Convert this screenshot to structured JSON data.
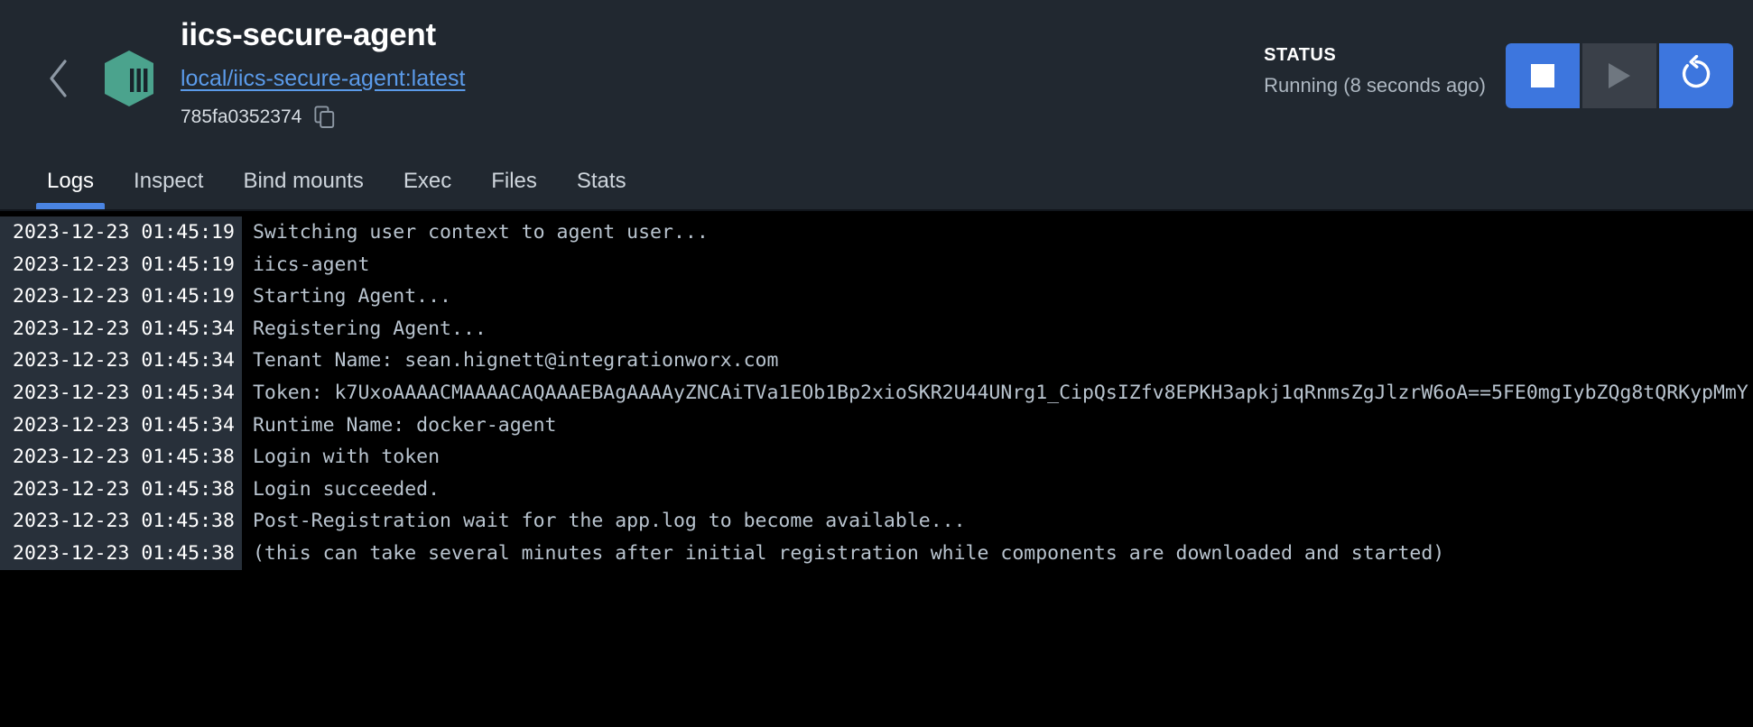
{
  "header": {
    "back_icon": "chevron-left-icon",
    "container_icon": "container-hexagon-icon",
    "container_name": "iics-secure-agent",
    "image_link": "local/iics-secure-agent:latest",
    "container_id": "785fa0352374",
    "copy_icon": "copy-icon",
    "status_label": "STATUS",
    "status_value": "Running (8 seconds ago)",
    "controls": {
      "stop": {
        "label": "Stop",
        "icon": "stop-square-icon",
        "enabled": true
      },
      "start": {
        "label": "Start",
        "icon": "play-triangle-icon",
        "enabled": false
      },
      "restart": {
        "label": "Restart",
        "icon": "restart-circular-arrow-icon",
        "enabled": true
      }
    }
  },
  "colors": {
    "header_bg": "#212830",
    "logs_bg": "#000000",
    "accent_blue": "#4a84e2",
    "button_blue": "#3d76de",
    "link_blue": "#5b9bea",
    "container_teal": "#4ba38d",
    "timestamp_bg": "#28303a",
    "log_text": "#b9c4cf"
  },
  "tabs": [
    {
      "label": "Logs",
      "active": true
    },
    {
      "label": "Inspect",
      "active": false
    },
    {
      "label": "Bind mounts",
      "active": false
    },
    {
      "label": "Exec",
      "active": false
    },
    {
      "label": "Files",
      "active": false
    },
    {
      "label": "Stats",
      "active": false
    }
  ],
  "logs": [
    {
      "timestamp": "2023-12-23 01:45:19",
      "message": "Switching user context to agent user..."
    },
    {
      "timestamp": "2023-12-23 01:45:19",
      "message": "iics-agent"
    },
    {
      "timestamp": "2023-12-23 01:45:19",
      "message": "Starting Agent..."
    },
    {
      "timestamp": "2023-12-23 01:45:34",
      "message": "Registering Agent..."
    },
    {
      "timestamp": "2023-12-23 01:45:34",
      "message": "Tenant Name: sean.hignett@integrationworx.com"
    },
    {
      "timestamp": "2023-12-23 01:45:34",
      "message": "Token: k7UxoAAAACMAAAACAQAAAEBAgAAAAyZNCAiTVa1EOb1Bp2xioSKR2U44UNrg1_CipQsIZfv8EPKH3apkj1qRnmsZgJlzrW6oA==5FE0mgIybZQg8tQRKypMmY"
    },
    {
      "timestamp": "2023-12-23 01:45:34",
      "message": "Runtime Name: docker-agent"
    },
    {
      "timestamp": "2023-12-23 01:45:38",
      "message": "Login with token"
    },
    {
      "timestamp": "2023-12-23 01:45:38",
      "message": "Login succeeded."
    },
    {
      "timestamp": "2023-12-23 01:45:38",
      "message": "Post-Registration wait for the app.log to become available..."
    },
    {
      "timestamp": "2023-12-23 01:45:38",
      "message": "(this can take several minutes after initial registration while components are downloaded and started)"
    }
  ]
}
